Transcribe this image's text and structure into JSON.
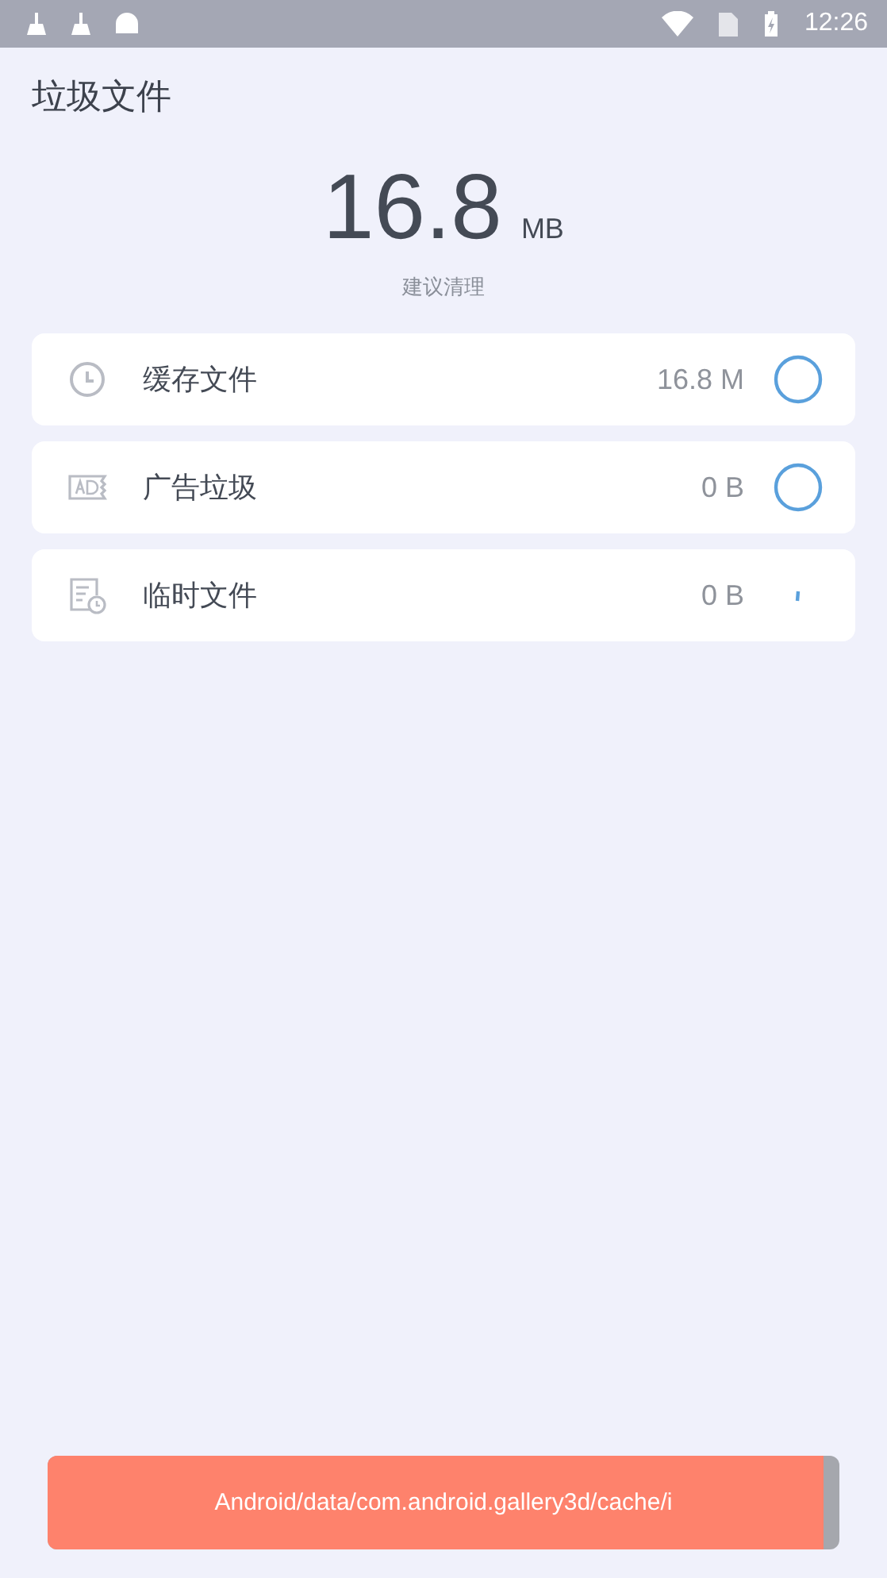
{
  "status_bar": {
    "time": "12:26"
  },
  "title": "垃圾文件",
  "summary": {
    "size": "16.8",
    "unit": "MB",
    "hint": "建议清理"
  },
  "items": [
    {
      "label": "缓存文件",
      "size": "16.8 M",
      "kind": "scanned"
    },
    {
      "label": "广告垃圾",
      "size": "0 B",
      "kind": "scanned"
    },
    {
      "label": "临时文件",
      "size": "0 B",
      "kind": "scanning"
    }
  ],
  "progress": {
    "path": "Android/data/com.android.gallery3d/cache/i",
    "level": 0.98
  }
}
